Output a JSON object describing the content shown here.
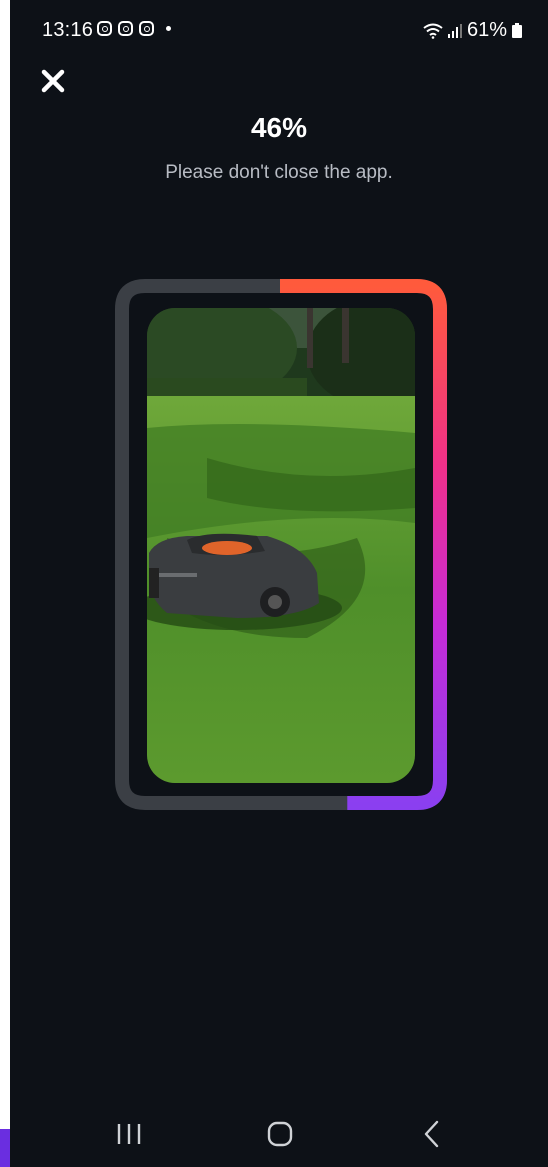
{
  "status_bar": {
    "time": "13:16",
    "notification_icons": [
      "instagram-icon",
      "instagram-icon",
      "instagram-icon"
    ],
    "battery": "61%",
    "icons": [
      "wifi-icon",
      "signal-icon",
      "battery-icon"
    ]
  },
  "header": {
    "close_icon": "close-icon"
  },
  "progress": {
    "percent_label": "46%",
    "fraction": 0.46,
    "message": "Please don't close the app.",
    "track_color": "#3b3f45",
    "gradient_colors": [
      "#ff5a3c",
      "#f0308a",
      "#c72bd6",
      "#8b3ff0"
    ]
  },
  "image": {
    "description_icon": "robotic-lawn-mower-photo"
  },
  "nav_bar": {
    "items": [
      "recents-icon",
      "home-icon",
      "back-icon"
    ]
  },
  "colors": {
    "background": "#0d1117",
    "accent_left": "#6a2ee0"
  }
}
